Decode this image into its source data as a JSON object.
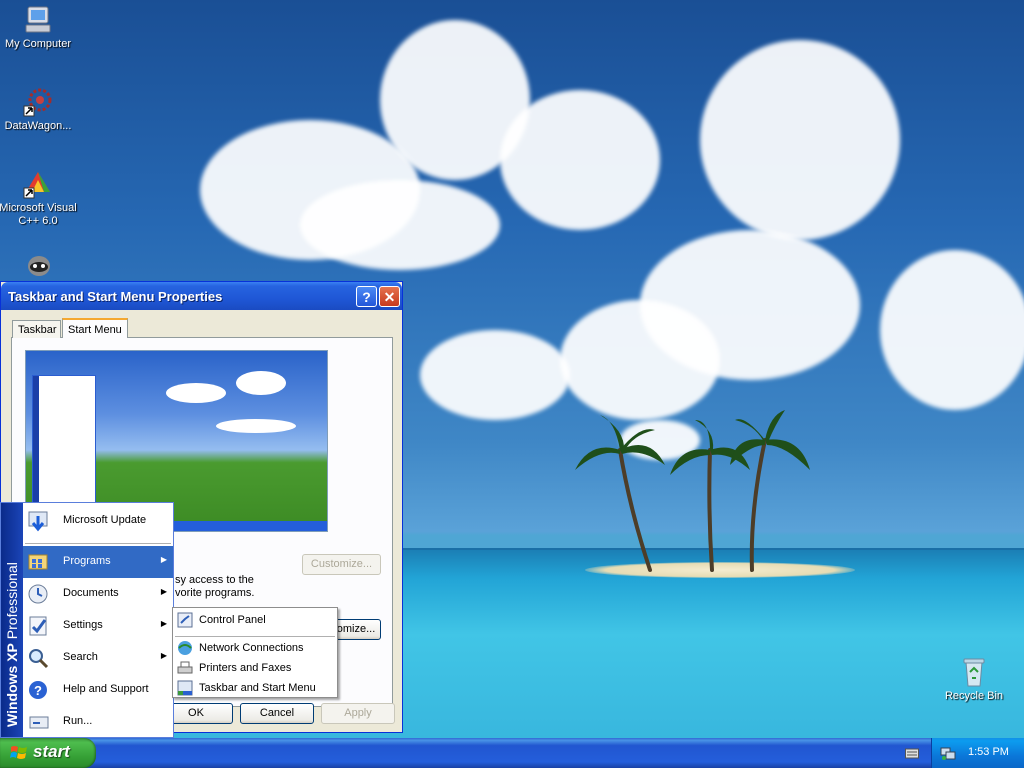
{
  "desktop": {
    "icons": [
      {
        "label": "My Computer",
        "icon": "my-computer-icon"
      },
      {
        "label": "DataWagon...",
        "icon": "datawagon-shortcut-icon"
      },
      {
        "label": "Microsoft Visual C++ 6.0",
        "icon": "visual-cpp-shortcut-icon"
      },
      {
        "label": "",
        "icon": "raccoon-shortcut-icon"
      },
      {
        "label": "Recycle Bin",
        "icon": "recycle-bin-icon"
      }
    ]
  },
  "dialog": {
    "title": "Taskbar and Start Menu Properties",
    "help_button": "?",
    "close_button": "✕",
    "tabs": [
      {
        "label": "Taskbar",
        "selected": false
      },
      {
        "label": "Start Menu",
        "selected": true
      }
    ],
    "customize_top": "Customize...",
    "description_line1": "sy access to the",
    "description_line2": "vorite programs.",
    "customize_bottom": "omize...",
    "ok": "OK",
    "cancel": "Cancel",
    "apply": "Apply"
  },
  "start_menu": {
    "band": {
      "brand": "Windows XP",
      "edition": "Professional"
    },
    "items": [
      {
        "label": "Microsoft Update",
        "icon": "microsoft-update-icon",
        "submenu": false
      },
      {
        "label": "Programs",
        "icon": "programs-icon",
        "submenu": true
      },
      {
        "label": "Documents",
        "icon": "documents-icon",
        "submenu": true
      },
      {
        "label": "Settings",
        "icon": "settings-icon",
        "submenu": true
      },
      {
        "label": "Search",
        "icon": "search-icon",
        "submenu": true
      },
      {
        "label": "Help and Support",
        "icon": "help-icon",
        "submenu": false
      },
      {
        "label": "Run...",
        "icon": "run-icon",
        "submenu": false
      }
    ],
    "arrow": "▶"
  },
  "settings_submenu": {
    "items": [
      {
        "label": "Control Panel",
        "icon": "control-panel-icon"
      },
      {
        "label": "Network Connections",
        "icon": "network-connections-icon"
      },
      {
        "label": "Printers and Faxes",
        "icon": "printers-icon"
      },
      {
        "label": "Taskbar and Start Menu",
        "icon": "taskbar-icon"
      }
    ]
  },
  "taskbar": {
    "start_label": "start",
    "clock": "1:53 PM"
  },
  "colors": {
    "highlight": "#316ac5",
    "titlebar": "#2663e0",
    "start_green": "#3c9a3c",
    "taskbar_blue": "#245edb"
  }
}
